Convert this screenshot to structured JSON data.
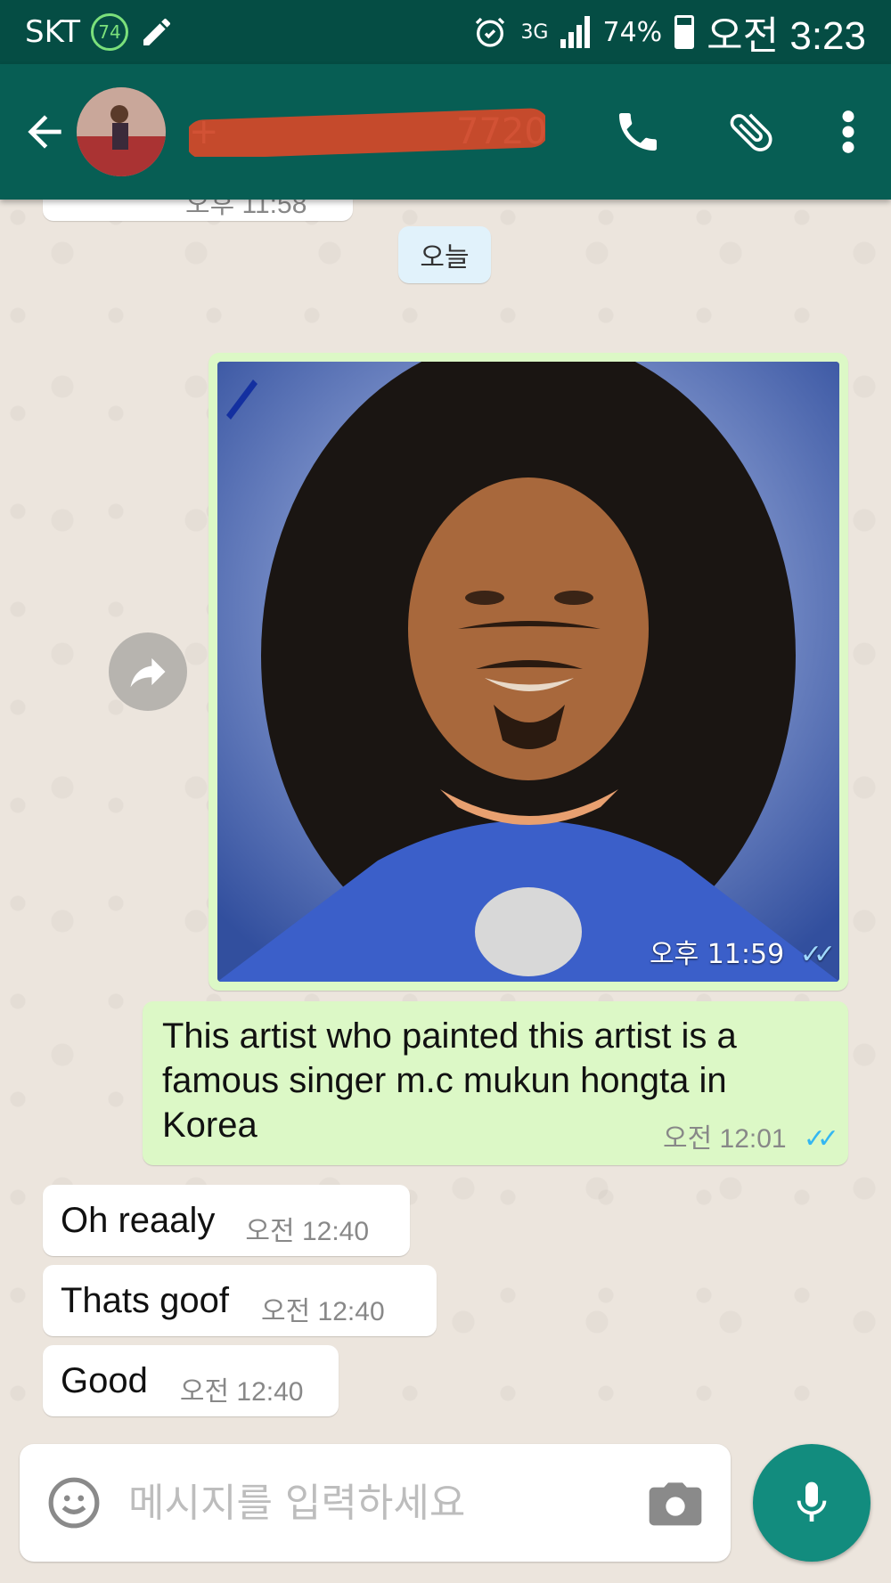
{
  "status_bar": {
    "carrier": "SKT",
    "notification_count": "74",
    "network": "3G",
    "battery": "74%",
    "time": "오전 3:23"
  },
  "header": {
    "contact_name": "+",
    "contact_suffix": "7720"
  },
  "chat": {
    "prev_time": "오후 11:58",
    "date_chip": "오늘",
    "photo_message": {
      "time": "오후 11:59",
      "status": "read"
    },
    "outgoing_text": {
      "text": "This artist who painted this artist is a famous singer m.c mukun hongta in Korea",
      "time": "오전 12:01"
    },
    "incoming": [
      {
        "text": "Oh reaaly",
        "time": "오전 12:40"
      },
      {
        "text": "Thats goof",
        "time": "오전 12:40"
      },
      {
        "text": "Good",
        "time": "오전 12:40"
      }
    ]
  },
  "composer": {
    "placeholder": "메시지를 입력하세요"
  },
  "colors": {
    "header": "#075e54",
    "status_bar": "#054d44",
    "outgoing_bubble": "#dcf8c6",
    "incoming_bubble": "#ffffff",
    "mic_button": "#128c7e",
    "read_ticks": "#34b7f1"
  }
}
